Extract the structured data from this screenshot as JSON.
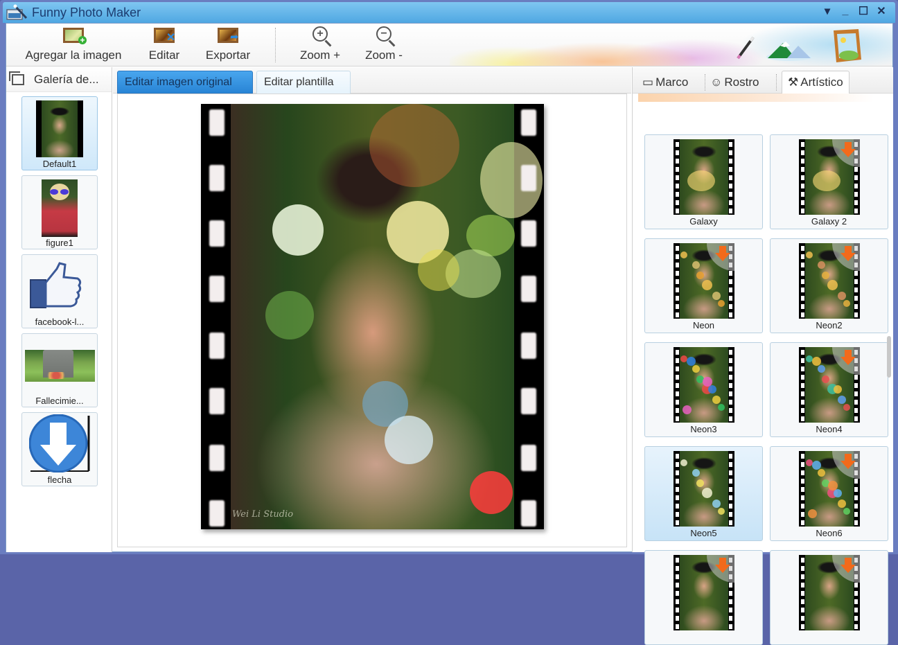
{
  "window": {
    "title": "Funny Photo Maker",
    "controls": {
      "menu": "▾",
      "minimize": "_",
      "maximize": "☐",
      "close": "✕"
    }
  },
  "toolbar": {
    "buttons": [
      {
        "label": "Agregar la imagen",
        "icon": "add-image-icon"
      },
      {
        "label": "Editar",
        "icon": "edit-image-icon"
      },
      {
        "label": "Exportar",
        "icon": "export-image-icon"
      },
      {
        "label": "Zoom +",
        "icon": "zoom-in-icon"
      },
      {
        "label": "Zoom -",
        "icon": "zoom-out-icon"
      }
    ],
    "zoom_in_glyph": "+",
    "zoom_out_glyph": "−"
  },
  "gallery": {
    "title": "Galería de...",
    "items": [
      {
        "label": "Default1",
        "selected": true
      },
      {
        "label": "figure1",
        "selected": false
      },
      {
        "label": "facebook-l...",
        "selected": false
      },
      {
        "label": "Fallecimie...",
        "selected": false
      },
      {
        "label": "flecha",
        "selected": false
      }
    ]
  },
  "editor": {
    "tabs": [
      {
        "label": "Editar imagen original",
        "active": true
      },
      {
        "label": "Editar plantilla",
        "active": false
      }
    ],
    "watermark": "Wei Li Studio"
  },
  "effects": {
    "tabs": [
      {
        "label": "Marco",
        "icon": "frame-icon",
        "glyph": "▭",
        "active": false
      },
      {
        "label": "Rostro",
        "icon": "face-icon",
        "glyph": "☺",
        "active": false
      },
      {
        "label": "Artístico",
        "icon": "magic-wand-icon",
        "glyph": "⚒",
        "active": true
      }
    ],
    "items": [
      {
        "label": "Galaxy",
        "download": false,
        "selected": false
      },
      {
        "label": "Galaxy 2",
        "download": true,
        "selected": false
      },
      {
        "label": "Neon",
        "download": true,
        "selected": false
      },
      {
        "label": "Neon2",
        "download": true,
        "selected": false
      },
      {
        "label": "Neon3",
        "download": false,
        "selected": false
      },
      {
        "label": "Neon4",
        "download": true,
        "selected": false
      },
      {
        "label": "Neon5",
        "download": false,
        "selected": true
      },
      {
        "label": "Neon6",
        "download": true,
        "selected": false
      },
      {
        "label": "",
        "download": true,
        "selected": false
      },
      {
        "label": "",
        "download": true,
        "selected": false
      }
    ]
  },
  "colors": {
    "titlebar": "#4fa7e2",
    "active_tab": "#2884d5",
    "download_arrow": "#f26a1b",
    "selected_item": "#cfe8fa"
  }
}
